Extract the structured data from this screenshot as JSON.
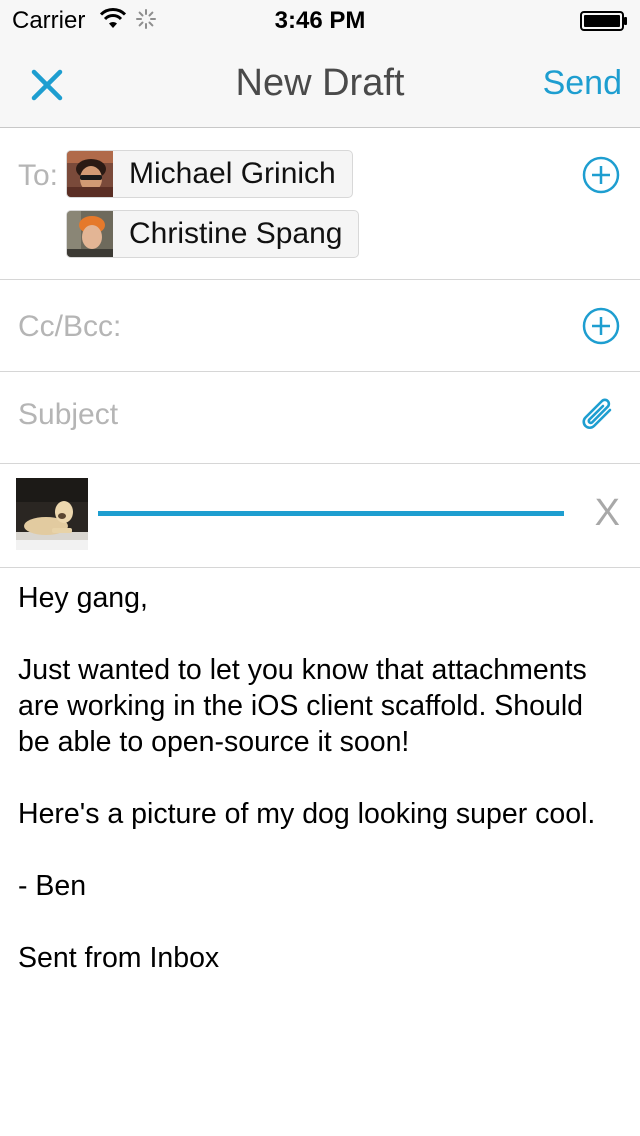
{
  "status_bar": {
    "carrier": "Carrier",
    "time": "3:46 PM"
  },
  "nav": {
    "title": "New Draft",
    "send_label": "Send",
    "accent_color": "#1e9ed0"
  },
  "to_field": {
    "label": "To:",
    "recipients": [
      {
        "name": "Michael Grinich"
      },
      {
        "name": "Christine Spang"
      }
    ]
  },
  "cc_field": {
    "label": "Cc/Bcc:"
  },
  "subject_field": {
    "placeholder": "Subject"
  },
  "attachment": {
    "remove_label": "X",
    "upload_progress": 1.0
  },
  "body": {
    "paragraphs": [
      "Hey gang,",
      "Just wanted to let you know that attachments are working in the iOS client scaffold. Should be able to open-source it soon!",
      "Here's a picture of my dog looking super cool.",
      "- Ben",
      "Sent from Inbox"
    ]
  },
  "icons": {
    "close": "close-icon",
    "add_recipient": "plus-circle-icon",
    "attach": "paperclip-icon"
  }
}
